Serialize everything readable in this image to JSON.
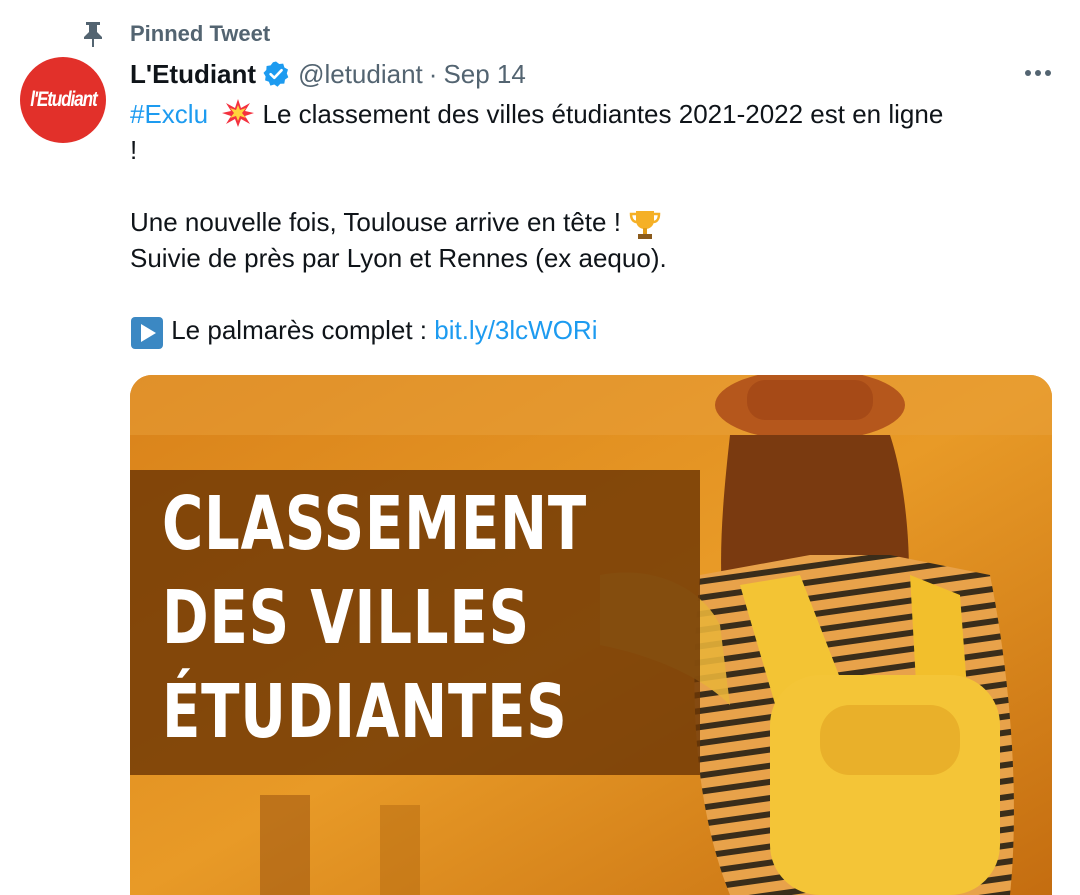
{
  "pinned_label": "Pinned Tweet",
  "account": {
    "display_name": "L'Etudiant",
    "handle": "@letudiant",
    "separator": "·",
    "date": "Sep 14",
    "avatar_text": "l'Etudiant"
  },
  "tweet": {
    "hashtag": "#Exclu",
    "line1_rest": " Le classement des villes étudiantes 2021-2022 est en ligne",
    "line2": "!",
    "line4": "Une nouvelle fois, Toulouse arrive en tête ! ",
    "line5": "Suivie de près par Lyon et Rennes (ex aequo).",
    "line7_prefix": " Le palmarès complet : ",
    "link": "bit.ly/3lcWORi"
  },
  "media": {
    "headline_lines": [
      "CLASSEMENT",
      "DES VILLES",
      "ÉTUDIANTES"
    ]
  },
  "colors": {
    "link": "#1d9bf0",
    "verified": "#1d9bf0",
    "avatar_bg": "#e2302a",
    "muted_text": "#536471"
  },
  "icons": {
    "pin": "pin-icon",
    "verified": "verified-badge-icon",
    "more": "more-options-icon",
    "explosion": "collision-emoji",
    "trophy": "trophy-emoji",
    "play": "play-button-emoji"
  }
}
